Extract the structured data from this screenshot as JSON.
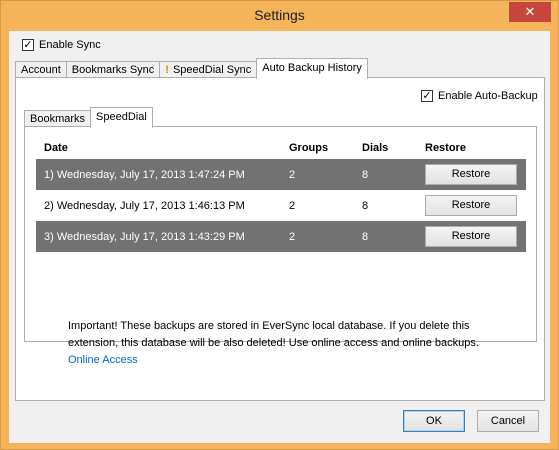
{
  "window": {
    "title": "Settings",
    "close_label": "✕"
  },
  "enable_sync": {
    "label": "Enable Sync",
    "checked": true
  },
  "main_tabs": [
    {
      "label": "Account",
      "active": false
    },
    {
      "label": "Bookmarks Sync",
      "active": false
    },
    {
      "label": "SpeedDial Sync",
      "active": false,
      "warning_icon": "exclamation-icon"
    },
    {
      "label": "Auto Backup History",
      "active": true
    }
  ],
  "auto_backup": {
    "label": "Enable Auto-Backup",
    "checked": true
  },
  "sub_tabs": [
    {
      "label": "Bookmarks",
      "active": false
    },
    {
      "label": "SpeedDial",
      "active": true
    }
  ],
  "table": {
    "headers": {
      "date": "Date",
      "groups": "Groups",
      "dials": "Dials",
      "restore": "Restore"
    },
    "rows": [
      {
        "date": "1) Wednesday, July 17, 2013 1:47:24 PM",
        "groups": "2",
        "dials": "8",
        "action": "Restore"
      },
      {
        "date": "2) Wednesday, July 17, 2013 1:46:13 PM",
        "groups": "2",
        "dials": "8",
        "action": "Restore"
      },
      {
        "date": "3) Wednesday, July 17, 2013 1:43:29 PM",
        "groups": "2",
        "dials": "8",
        "action": "Restore"
      }
    ]
  },
  "notice": {
    "text": "Important! These backups are stored in EverSync local database. If you delete this extension, this database will be also deleted! Use online access and online backups.",
    "link": "Online Access"
  },
  "buttons": {
    "ok": "OK",
    "cancel": "Cancel"
  },
  "colors": {
    "accent": "#f6b45a",
    "selected_row": "#727272",
    "link": "#0066cc"
  }
}
